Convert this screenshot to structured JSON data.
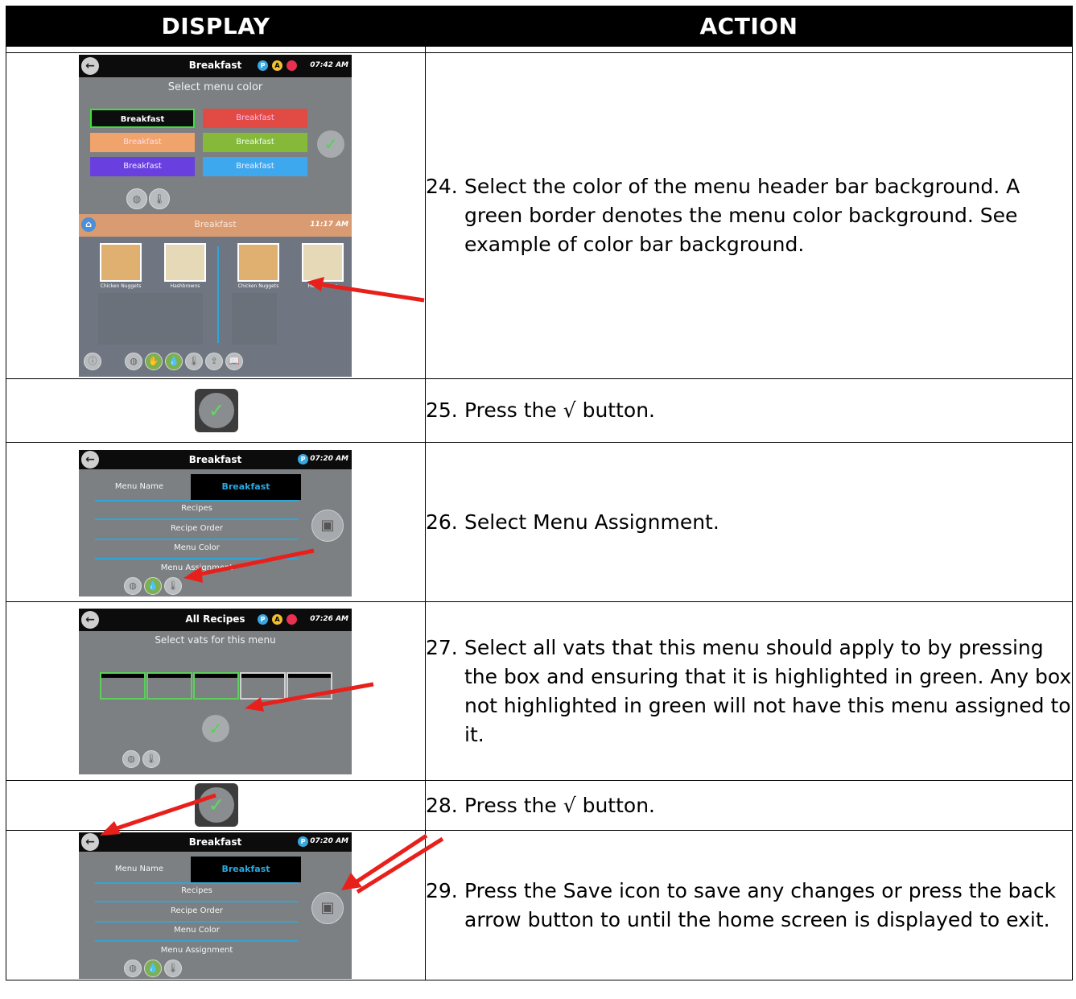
{
  "header": {
    "display": "DISPLAY",
    "action": "ACTION"
  },
  "steps": [
    {
      "num": "24.",
      "text": "Select the color of the menu header bar background. A green border denotes the menu color background. See example of color bar background."
    },
    {
      "num": "25.",
      "text": "Press the √ button."
    },
    {
      "num": "26.",
      "text": "Select Menu Assignment."
    },
    {
      "num": "27.",
      "text": "Select all vats that this menu should apply to by pressing the box and ensuring that it is highlighted in green. Any box not highlighted in green will not have this menu assigned to it."
    },
    {
      "num": "28.",
      "text": "Press the √ button."
    },
    {
      "num": "29.",
      "text": "Press the Save icon to save any changes or press the back arrow button to until the home screen is displayed to exit."
    }
  ],
  "screen_color": {
    "title": "Breakfast",
    "time": "07:42 AM",
    "prompt": "Select menu color",
    "buttons": [
      "Breakfast",
      "Breakfast",
      "Breakfast",
      "Breakfast",
      "Breakfast",
      "Breakfast"
    ],
    "button_colors": [
      "#0d0d0d",
      "#e24a44",
      "#f0a36a",
      "#86b83a",
      "#6a3fe0",
      "#3ea8ef"
    ]
  },
  "screen_home": {
    "title": "Breakfast",
    "time": "11:17 AM",
    "items": [
      "Chicken Nuggets",
      "Hashbrowns",
      "Chicken Nuggets",
      "Hashbrowns"
    ]
  },
  "screen_menu": {
    "title": "Breakfast",
    "time": "07:20 AM",
    "menu_name_label": "Menu Name",
    "menu_name_value": "Breakfast",
    "rows": [
      "Recipes",
      "Recipe Order",
      "Menu Color",
      "Menu Assignment"
    ]
  },
  "screen_vats": {
    "title": "All Recipes",
    "time": "07:26 AM",
    "prompt": "Select vats for this menu"
  },
  "icons": {
    "back": "back-arrow-icon",
    "check": "check-icon",
    "save": "save-icon",
    "globe": "globe-icon",
    "thermo": "thermometer-icon",
    "home": "home-icon"
  }
}
